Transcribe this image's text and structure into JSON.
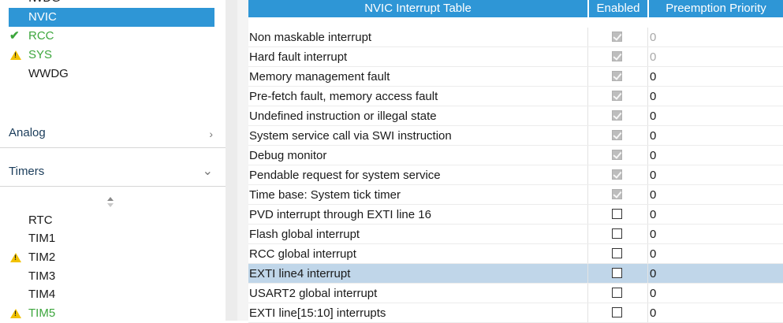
{
  "sidebar": {
    "items_top": [
      {
        "label": "IWDG",
        "state": "none"
      },
      {
        "label": "NVIC",
        "state": "selected"
      },
      {
        "label": "RCC",
        "state": "ok"
      },
      {
        "label": "SYS",
        "state": "warning"
      },
      {
        "label": "WWDG",
        "state": "none"
      }
    ],
    "categories": [
      {
        "label": "Analog",
        "chevron": "chevron-right"
      },
      {
        "label": "Timers",
        "chevron": "chevron-down"
      }
    ],
    "timers": [
      {
        "label": "RTC",
        "state": "none"
      },
      {
        "label": "TIM1",
        "state": "none"
      },
      {
        "label": "TIM2",
        "state": "warning"
      },
      {
        "label": "TIM3",
        "state": "none"
      },
      {
        "label": "TIM4",
        "state": "none"
      },
      {
        "label": "TIM5",
        "state": "warning"
      }
    ]
  },
  "table": {
    "headers": [
      "NVIC Interrupt Table",
      "Enabled",
      "Preemption Priority"
    ],
    "rows": [
      {
        "name": "Non maskable interrupt",
        "enabled": true,
        "locked": true,
        "priority": "0",
        "priority_muted": true
      },
      {
        "name": "Hard fault interrupt",
        "enabled": true,
        "locked": true,
        "priority": "0",
        "priority_muted": true
      },
      {
        "name": "Memory management fault",
        "enabled": true,
        "locked": true,
        "priority": "0"
      },
      {
        "name": "Pre-fetch fault, memory access fault",
        "enabled": true,
        "locked": true,
        "priority": "0"
      },
      {
        "name": "Undefined instruction or illegal state",
        "enabled": true,
        "locked": true,
        "priority": "0"
      },
      {
        "name": "System service call via SWI instruction",
        "enabled": true,
        "locked": true,
        "priority": "0"
      },
      {
        "name": "Debug monitor",
        "enabled": true,
        "locked": true,
        "priority": "0"
      },
      {
        "name": "Pendable request for system service",
        "enabled": true,
        "locked": true,
        "priority": "0"
      },
      {
        "name": "Time base: System tick timer",
        "enabled": true,
        "locked": true,
        "priority": "0"
      },
      {
        "name": "PVD interrupt through EXTI line 16",
        "enabled": false,
        "priority": "0"
      },
      {
        "name": "Flash global interrupt",
        "enabled": false,
        "priority": "0"
      },
      {
        "name": "RCC global interrupt",
        "enabled": false,
        "priority": "0"
      },
      {
        "name": "EXTI line4 interrupt",
        "enabled": false,
        "priority": "0",
        "highlighted": true
      },
      {
        "name": "USART2 global interrupt",
        "enabled": false,
        "priority": "0"
      },
      {
        "name": "EXTI line[15:10] interrupts",
        "enabled": false,
        "priority": "0"
      }
    ]
  },
  "colors": {
    "accent": "#2e96d6",
    "ok": "#3da63d",
    "warning": "#f2c200",
    "row_highlight": "#c0d6e9"
  }
}
